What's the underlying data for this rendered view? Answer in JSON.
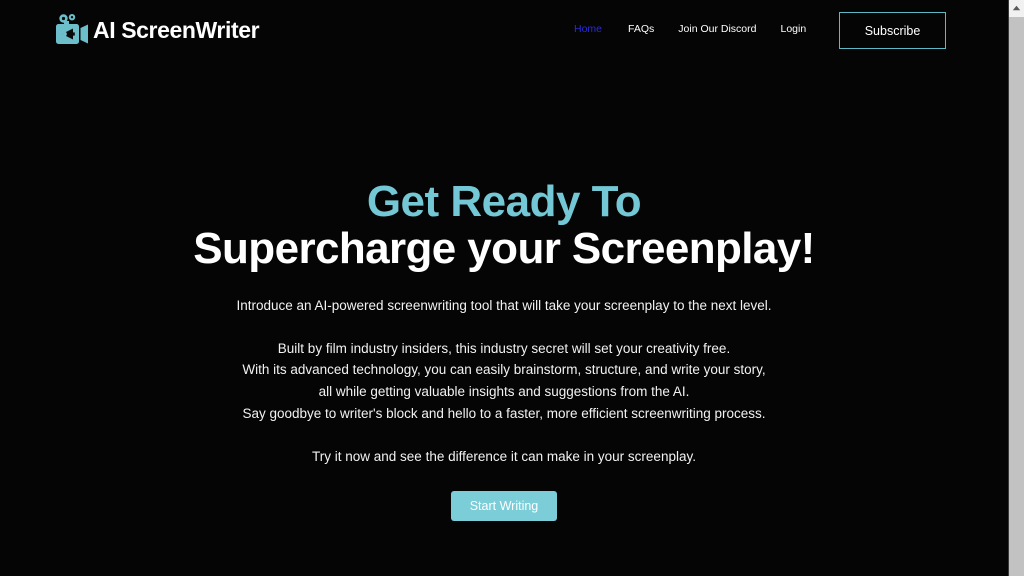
{
  "browser": {
    "scrollbar": {
      "up_arrow_icon": "scroll-up-arrow-icon",
      "thumb_label": "",
      "track_color": "#f1f1f1",
      "thumb_color": "#c2c2c2"
    }
  },
  "theme": {
    "background": "#000000",
    "accent_teal": "#74c7d4",
    "button_teal": "#7bcdd8",
    "active_link_blue": "#2b2bd4",
    "text_white": "#ffffff"
  },
  "header": {
    "logo_icon": "movie-camera-pen-icon",
    "brand_name": "AI ScreenWriter",
    "nav": [
      {
        "label": "Home",
        "active": true
      },
      {
        "label": "FAQs",
        "active": false
      },
      {
        "label": "Join Our Discord",
        "active": false
      },
      {
        "label": "Login",
        "active": false
      }
    ],
    "subscribe_label": "Subscribe"
  },
  "hero": {
    "title_line1": "Get Ready To",
    "title_line2": "Supercharge your Screenplay!",
    "lede": "Introduce an AI-powered screenwriting tool that will take your screenplay to the next level.",
    "body_lines": [
      "Built by film industry insiders, this industry secret will set your creativity free.",
      "With its advanced technology, you can easily brainstorm, structure, and write your story,",
      "all while getting valuable insights and suggestions from the AI.",
      "Say goodbye to writer's block and hello to a faster, more efficient screenwriting process."
    ],
    "closing": "Try it now and see the difference it can make in your screenplay.",
    "cta_label": "Start Writing"
  }
}
